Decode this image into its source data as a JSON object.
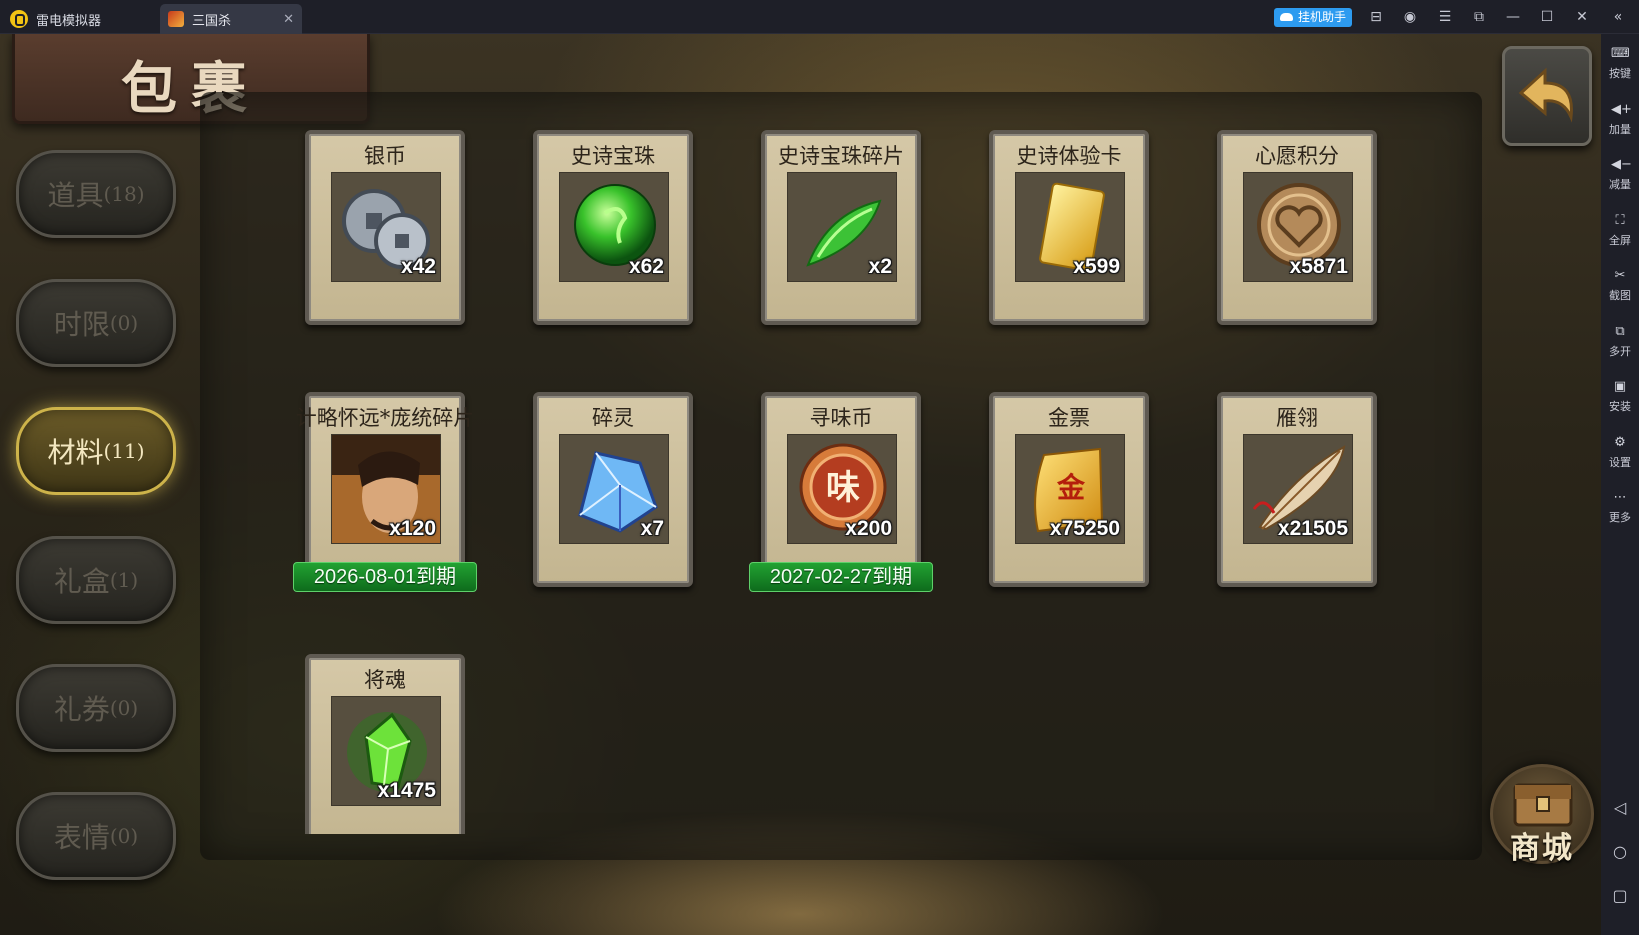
{
  "titlebar": {
    "app_name": "雷电模拟器",
    "game_tab": "三国杀",
    "tab_close": "✕",
    "assist_label": "挂机助手",
    "icons": [
      "gift-icon",
      "account-icon",
      "menu-icon",
      "popout-icon",
      "minimize-icon",
      "maximize-icon",
      "close-icon"
    ]
  },
  "sidebar": {
    "items": [
      {
        "label": "按键",
        "icon": "keyboard-icon"
      },
      {
        "label": "加量",
        "icon": "volume-up-icon"
      },
      {
        "label": "减量",
        "icon": "volume-down-icon"
      },
      {
        "label": "全屏",
        "icon": "fullscreen-icon"
      },
      {
        "label": "截图",
        "icon": "scissors-icon"
      },
      {
        "label": "多开",
        "icon": "multi-instance-icon"
      },
      {
        "label": "安装",
        "icon": "apk-icon"
      },
      {
        "label": "设置",
        "icon": "settings-icon"
      },
      {
        "label": "更多",
        "icon": "more-icon"
      }
    ],
    "nav": [
      "back-nav-icon",
      "home-nav-icon",
      "recents-nav-icon"
    ]
  },
  "game": {
    "title": "包裹",
    "shop_label": "商城",
    "categories": [
      {
        "label": "道具",
        "count": "(18)",
        "active": false
      },
      {
        "label": "时限",
        "count": "(0)",
        "active": false
      },
      {
        "label": "材料",
        "count": "(11)",
        "active": true
      },
      {
        "label": "礼盒",
        "count": "(1)",
        "active": false
      },
      {
        "label": "礼券",
        "count": "(0)",
        "active": false
      },
      {
        "label": "表情",
        "count": "(0)",
        "active": false
      }
    ],
    "items": [
      {
        "name": "银币",
        "qty": "x42",
        "icon": "silver-coin-icon"
      },
      {
        "name": "史诗宝珠",
        "qty": "x62",
        "icon": "green-orb-icon"
      },
      {
        "name": "史诗宝珠碎片",
        "qty": "x2",
        "icon": "green-shard-icon"
      },
      {
        "name": "史诗体验卡",
        "qty": "x599",
        "icon": "gold-card-icon"
      },
      {
        "name": "心愿积分",
        "qty": "x5871",
        "icon": "heart-coin-icon"
      },
      {
        "name": "计略怀远*庞统碎片",
        "qty": "x120",
        "icon": "general-portrait-icon",
        "expire": "2026-08-01到期"
      },
      {
        "name": "碎灵",
        "qty": "x7",
        "icon": "blue-crystal-icon"
      },
      {
        "name": "寻味币",
        "qty": "x200",
        "icon": "flavor-coin-icon",
        "expire": "2027-02-27到期",
        "coin_char": "味"
      },
      {
        "name": "金票",
        "qty": "x75250",
        "icon": "gold-ticket-icon",
        "ticket_char": "金"
      },
      {
        "name": "雁翎",
        "qty": "x21505",
        "icon": "feather-icon"
      },
      {
        "name": "将魂",
        "qty": "x1475",
        "icon": "soul-crystal-icon"
      }
    ]
  }
}
